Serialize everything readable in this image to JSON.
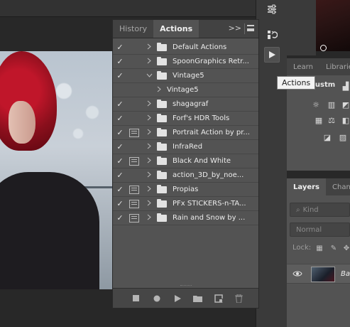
{
  "tooltip": "Actions",
  "actions_panel": {
    "tabs": [
      "History",
      "Actions"
    ],
    "active_tab": "Actions",
    "collapse_label": ">>",
    "items": [
      {
        "label": "Default Actions",
        "checked": true,
        "dialog": false,
        "expanded": false,
        "type": "set"
      },
      {
        "label": "SpoonGraphics Retr...",
        "checked": true,
        "dialog": false,
        "expanded": false,
        "type": "set"
      },
      {
        "label": "Vintage5",
        "checked": true,
        "dialog": false,
        "expanded": true,
        "type": "set"
      },
      {
        "label": "Vintage5",
        "checked": false,
        "dialog": false,
        "expanded": false,
        "type": "action"
      },
      {
        "label": "shagagraf",
        "checked": true,
        "dialog": false,
        "expanded": false,
        "type": "set"
      },
      {
        "label": "Forf's HDR Tools",
        "checked": true,
        "dialog": false,
        "expanded": false,
        "type": "set"
      },
      {
        "label": "Portrait Action by pr...",
        "checked": true,
        "dialog": true,
        "expanded": false,
        "type": "set"
      },
      {
        "label": "InfraRed",
        "checked": true,
        "dialog": false,
        "expanded": false,
        "type": "set"
      },
      {
        "label": "Black And White",
        "checked": true,
        "dialog": true,
        "expanded": false,
        "type": "set"
      },
      {
        "label": "action_3D_by_noe...",
        "checked": true,
        "dialog": false,
        "expanded": false,
        "type": "set"
      },
      {
        "label": "Propias",
        "checked": true,
        "dialog": true,
        "expanded": false,
        "type": "set"
      },
      {
        "label": "PFx STICKERS-n-TA...",
        "checked": true,
        "dialog": true,
        "expanded": false,
        "type": "set"
      },
      {
        "label": "Rain and Snow by ...",
        "checked": true,
        "dialog": true,
        "expanded": false,
        "type": "set"
      }
    ],
    "footer_buttons": [
      "stop-icon",
      "record-icon",
      "play-icon",
      "new-set-icon",
      "new-action-icon",
      "delete-icon"
    ]
  },
  "right_panels": {
    "learn_tabs": [
      "Learn",
      "Libraries"
    ],
    "adjustments_title": "n adjustm",
    "layers_tabs": [
      "Layers",
      "Channe"
    ],
    "kind_filter": "Kind",
    "blend_mode": "Normal",
    "lock_label": "Lock:",
    "layer_name": "Ba"
  },
  "colors": {
    "panel_bg": "#535353",
    "tab_bg": "#424242",
    "app_bg": "#282828"
  }
}
